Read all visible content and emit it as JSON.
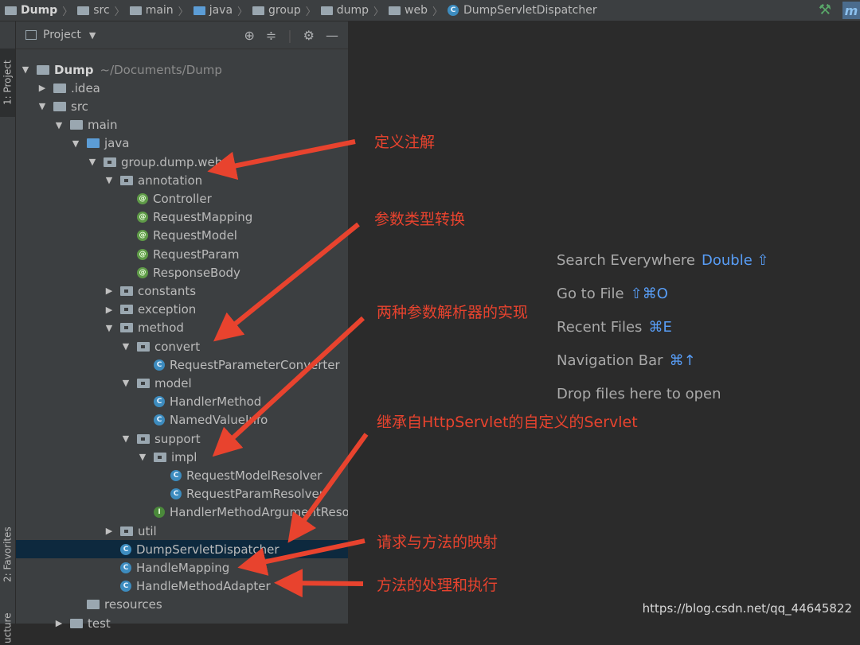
{
  "navbar": {
    "crumbs": [
      "Dump",
      "src",
      "main",
      "java",
      "group",
      "dump",
      "web",
      "DumpServletDispatcher"
    ],
    "right_icon": "hammer-icon",
    "corner_letter": "m"
  },
  "tool_strip": {
    "project_tab": "1: Project",
    "favorites_tab": "2: Favorites",
    "structure_tab": "ucture"
  },
  "panel": {
    "title": "Project",
    "header_icons": [
      "crosshair-icon",
      "collapse-icon",
      "gear-icon",
      "minimize-icon"
    ]
  },
  "tree": [
    {
      "label": "Dump",
      "hint": "~/Documents/Dump",
      "depth": 0,
      "twisty": "open",
      "icon": "module"
    },
    {
      "label": ".idea",
      "depth": 1,
      "twisty": "closed",
      "icon": "folder"
    },
    {
      "label": "src",
      "depth": 1,
      "twisty": "open",
      "icon": "folder"
    },
    {
      "label": "main",
      "depth": 2,
      "twisty": "open",
      "icon": "folder"
    },
    {
      "label": "java",
      "depth": 3,
      "twisty": "open",
      "icon": "source-folder"
    },
    {
      "label": "group.dump.web",
      "depth": 4,
      "twisty": "open",
      "icon": "package"
    },
    {
      "label": "annotation",
      "depth": 5,
      "twisty": "open",
      "icon": "package"
    },
    {
      "label": "Controller",
      "depth": 6,
      "twisty": "none",
      "icon": "annotation"
    },
    {
      "label": "RequestMapping",
      "depth": 6,
      "twisty": "none",
      "icon": "annotation"
    },
    {
      "label": "RequestModel",
      "depth": 6,
      "twisty": "none",
      "icon": "annotation"
    },
    {
      "label": "RequestParam",
      "depth": 6,
      "twisty": "none",
      "icon": "annotation"
    },
    {
      "label": "ResponseBody",
      "depth": 6,
      "twisty": "none",
      "icon": "annotation"
    },
    {
      "label": "constants",
      "depth": 5,
      "twisty": "closed",
      "icon": "package"
    },
    {
      "label": "exception",
      "depth": 5,
      "twisty": "closed",
      "icon": "package"
    },
    {
      "label": "method",
      "depth": 5,
      "twisty": "open",
      "icon": "package"
    },
    {
      "label": "convert",
      "depth": 6,
      "twisty": "open",
      "icon": "package"
    },
    {
      "label": "RequestParameterConverter",
      "depth": 7,
      "twisty": "none",
      "icon": "class"
    },
    {
      "label": "model",
      "depth": 6,
      "twisty": "open",
      "icon": "package"
    },
    {
      "label": "HandlerMethod",
      "depth": 7,
      "twisty": "none",
      "icon": "class"
    },
    {
      "label": "NamedValueInfo",
      "depth": 7,
      "twisty": "none",
      "icon": "class"
    },
    {
      "label": "support",
      "depth": 6,
      "twisty": "open",
      "icon": "package"
    },
    {
      "label": "impl",
      "depth": 7,
      "twisty": "open",
      "icon": "package"
    },
    {
      "label": "RequestModelResolver",
      "depth": 8,
      "twisty": "none",
      "icon": "class"
    },
    {
      "label": "RequestParamResolver",
      "depth": 8,
      "twisty": "none",
      "icon": "class"
    },
    {
      "label": "HandlerMethodArgumentResolver",
      "depth": 7,
      "twisty": "none",
      "icon": "interface"
    },
    {
      "label": "util",
      "depth": 5,
      "twisty": "closed",
      "icon": "package"
    },
    {
      "label": "DumpServletDispatcher",
      "depth": 5,
      "twisty": "none",
      "icon": "class",
      "selected": true
    },
    {
      "label": "HandleMapping",
      "depth": 5,
      "twisty": "none",
      "icon": "class"
    },
    {
      "label": "HandleMethodAdapter",
      "depth": 5,
      "twisty": "none",
      "icon": "class"
    },
    {
      "label": "resources",
      "depth": 3,
      "twisty": "none",
      "icon": "resources-folder"
    },
    {
      "label": "test",
      "depth": 2,
      "twisty": "closed",
      "icon": "folder"
    }
  ],
  "editor_hints": [
    {
      "text": "Search Everywhere",
      "key": "Double ⇧"
    },
    {
      "text": "Go to File",
      "key": "⇧⌘O"
    },
    {
      "text": "Recent Files",
      "key": "⌘E"
    },
    {
      "text": "Navigation Bar",
      "key": "⌘↑"
    },
    {
      "text": "Drop files here to open",
      "key": ""
    }
  ],
  "annotations": [
    "定义注解",
    "参数类型转换",
    "两种参数解析器的实现",
    "继承自HttpServlet的自定义的Servlet",
    "请求与方法的映射",
    "方法的处理和执行"
  ],
  "watermark": "https://blog.csdn.net/qq_44645822",
  "colors": {
    "annotation_red": "#e8432e",
    "shortcut_blue": "#589df6",
    "selection": "#0d293e"
  }
}
